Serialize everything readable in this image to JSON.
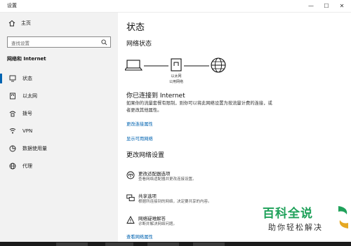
{
  "window": {
    "title": "设置",
    "minimize_glyph": "—",
    "maximize_glyph": "☐",
    "close_glyph": "✕"
  },
  "sidebar": {
    "home_label": "主页",
    "search_placeholder": "查找设置",
    "section_title": "网络和 Internet",
    "items": [
      {
        "label": "状态",
        "icon": "status-icon",
        "active": true
      },
      {
        "label": "以太网",
        "icon": "ethernet-icon",
        "active": false
      },
      {
        "label": "拨号",
        "icon": "dialup-icon",
        "active": false
      },
      {
        "label": "VPN",
        "icon": "vpn-icon",
        "active": false
      },
      {
        "label": "数据使用量",
        "icon": "data-usage-icon",
        "active": false
      },
      {
        "label": "代理",
        "icon": "proxy-icon",
        "active": false
      }
    ]
  },
  "main": {
    "title": "状态",
    "network_status_title": "网络状态",
    "diagram": {
      "node_label_1": "以太网",
      "node_label_2": "公用网络"
    },
    "connected_title": "你已连接到 Internet",
    "connected_desc": "如果你的流量套餐有限制，则你可以将此网络设置为按流量计费的连接，或者更改其他属性。",
    "links": [
      "更改连接属性",
      "显示可用网络"
    ],
    "change_title": "更改网络设置",
    "options": [
      {
        "name": "更改适配器选项",
        "desc": "查看网络适配器并更改连接设置。",
        "icon": "adapter-icon"
      },
      {
        "name": "共享选项",
        "desc": "根据所连接到的网络，决定要共享的内容。",
        "icon": "sharing-icon"
      },
      {
        "name": "网络疑难解答",
        "desc": "诊断并解决网络问题。",
        "icon": "troubleshoot-icon"
      }
    ],
    "bottom_link": "查看网络属性"
  },
  "watermark": {
    "main": "百科全说",
    "sub": "助你轻松解决"
  },
  "colors": {
    "accent": "#0063b1",
    "sidebar_bg": "#f2f2f2",
    "watermark_green": "#1fa15a"
  }
}
